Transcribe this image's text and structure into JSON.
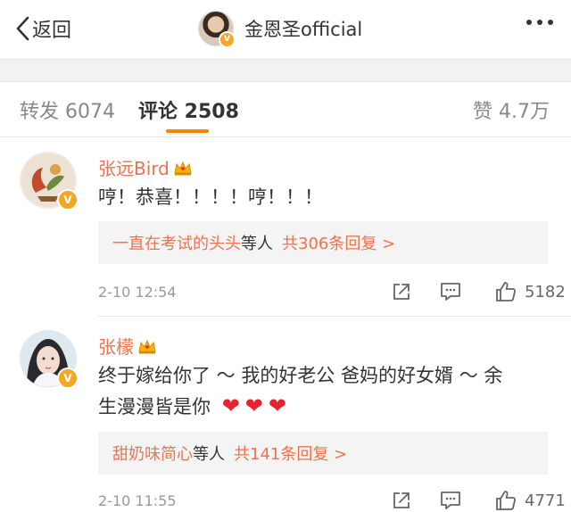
{
  "nav": {
    "back_label": "返回",
    "account_name": "金恩圣official"
  },
  "tabs": {
    "repost": "转发 6074",
    "comment": "评论 2508",
    "like": "赞 4.7万"
  },
  "comments": [
    {
      "user": "张远Bird",
      "text": "哼！恭喜！！！！哼！！！",
      "reply_names": "一直在考试的头头",
      "reply_mid": "等人",
      "reply_count": "共306条回复 >",
      "time": "2-10 12:54",
      "likes": "5182"
    },
    {
      "user": "张檬",
      "text_line1": "终于嫁给你了 ～ 我的好老公 爸妈的好女婿 ～ 余",
      "text_line2": "生漫漫皆是你",
      "reply_names": "甜奶味简心",
      "reply_mid": "等人",
      "reply_count": "共141条回复 >",
      "time": "2-10 11:55",
      "likes": "4771"
    }
  ],
  "colors": {
    "username": "#eb7350",
    "tab_indicator": "#ff8200",
    "heart": "#e8232f",
    "verified_badge": "#f5a623"
  }
}
